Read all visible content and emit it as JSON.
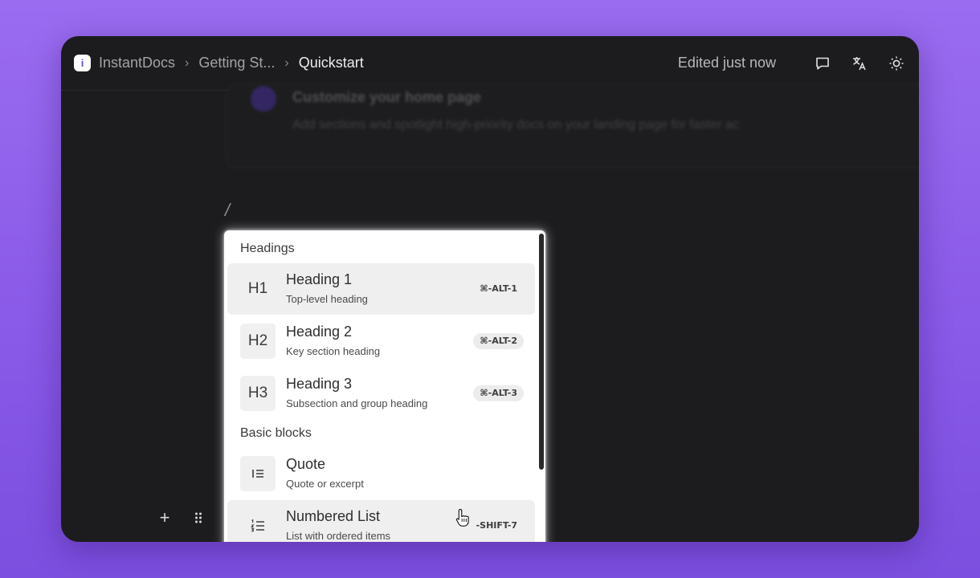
{
  "breadcrumb": {
    "items": [
      "InstantDocs",
      "Getting St...",
      "Quickstart"
    ]
  },
  "header": {
    "edited_status": "Edited just now"
  },
  "background_card": {
    "title": "Customize your home page",
    "description": "Add sections and spotlight high-priority docs on your landing page for faster ac"
  },
  "editor": {
    "slash_text": "/"
  },
  "block_menu": {
    "sections": [
      {
        "label": "Headings",
        "items": [
          {
            "icon": "H1",
            "title": "Heading 1",
            "subtitle": "Top-level heading",
            "shortcut": "⌘-ALT-1",
            "active": true
          },
          {
            "icon": "H2",
            "title": "Heading 2",
            "subtitle": "Key section heading",
            "shortcut": "⌘-ALT-2"
          },
          {
            "icon": "H3",
            "title": "Heading 3",
            "subtitle": "Subsection and group heading",
            "shortcut": "⌘-ALT-3"
          }
        ]
      },
      {
        "label": "Basic blocks",
        "items": [
          {
            "icon": "quote-icon",
            "title": "Quote",
            "subtitle": "Quote or excerpt",
            "shortcut": ""
          },
          {
            "icon": "numbered-list-icon",
            "title": "Numbered List",
            "subtitle": "List with ordered items",
            "shortcut": "-SHIFT-7",
            "active": true
          }
        ]
      }
    ]
  },
  "colors": {
    "background": "#8a5ae8",
    "window": "#1c1c1e",
    "menu": "#ffffff",
    "accent": "#6b4be0"
  }
}
